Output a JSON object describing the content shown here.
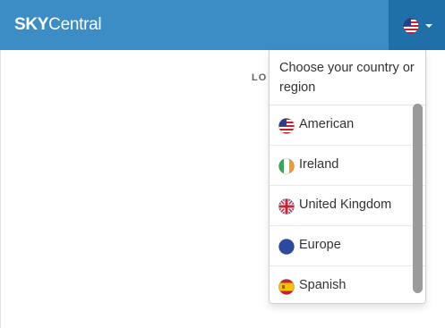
{
  "brand": {
    "bold": "SKY",
    "light": "Central"
  },
  "country_toggle": {
    "current_flag": "us-flag-icon"
  },
  "login_stub": "LO",
  "dropdown": {
    "header": "Choose your country or region",
    "items": [
      {
        "label": "American",
        "icon": "us-flag-icon"
      },
      {
        "label": "Ireland",
        "icon": "ireland-flag-icon"
      },
      {
        "label": "United Kingdom",
        "icon": "uk-flag-icon"
      },
      {
        "label": "Europe",
        "icon": "eu-flag-icon"
      },
      {
        "label": "Spanish",
        "icon": "spain-flag-icon"
      }
    ]
  },
  "colors": {
    "navbar": "#3c8dc5",
    "toggle": "#1f6fa8",
    "scrollbar": "#9b9b9b"
  }
}
